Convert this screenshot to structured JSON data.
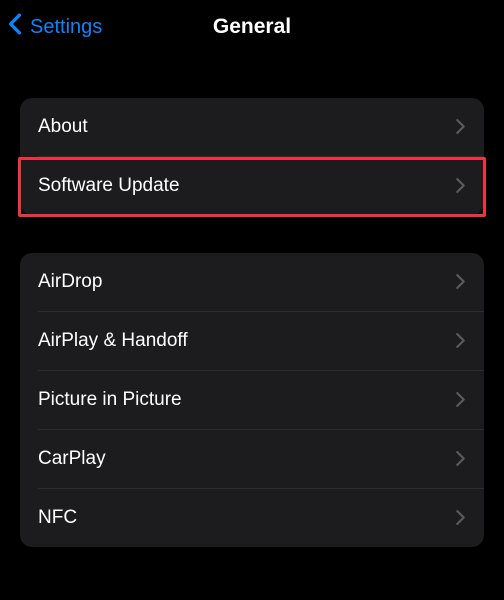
{
  "header": {
    "back_label": "Settings",
    "title": "General"
  },
  "groups": [
    {
      "rows": [
        {
          "id": "about",
          "label": "About"
        },
        {
          "id": "software-update",
          "label": "Software Update",
          "highlighted": true
        }
      ]
    },
    {
      "rows": [
        {
          "id": "airdrop",
          "label": "AirDrop"
        },
        {
          "id": "airplay-handoff",
          "label": "AirPlay & Handoff"
        },
        {
          "id": "picture-in-picture",
          "label": "Picture in Picture"
        },
        {
          "id": "carplay",
          "label": "CarPlay"
        },
        {
          "id": "nfc",
          "label": "NFC"
        }
      ]
    }
  ],
  "colors": {
    "accent": "#0a84ff",
    "highlight_border": "#ef3440",
    "group_bg": "#1c1c1e"
  }
}
